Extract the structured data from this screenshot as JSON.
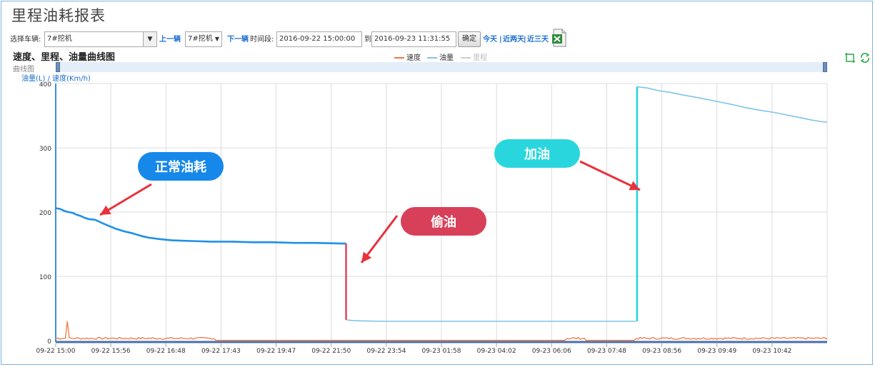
{
  "page": {
    "title": "里程油耗报表"
  },
  "toolbar": {
    "vehicle_label": "选择车辆:",
    "vehicle_value": "7#挖机",
    "prev_label": "上一辆",
    "vehicle_select_value": "7#挖机",
    "next_label": "下一辆",
    "period_label": "时间段:",
    "start_time": "2016-09-22 15:00:00",
    "to_label": "到",
    "end_time": "2016-09-23 11:31:55",
    "confirm_label": "确定",
    "quick_today": "今天",
    "quick_two_days": "近两天",
    "quick_three_days": "近三天",
    "separator": "|"
  },
  "chart_header": {
    "title": "速度、里程、油量曲线图",
    "navigator_label": "曲线图",
    "y_axis_title": "油量(L)  /  速度(Km/h)"
  },
  "colors": {
    "speed": "#f07840",
    "fuel": "#7ec4ea",
    "mileage": "#cccccc",
    "fuel_normal": "#1e90e8",
    "theft": "#d8405a",
    "refuel": "#26d4dc"
  },
  "chart_data": {
    "type": "line",
    "legend": [
      {
        "name": "速度",
        "color": "#f07840"
      },
      {
        "name": "油量",
        "color": "#7ec4ea"
      },
      {
        "name": "里程",
        "color": "#cccccc",
        "disabled": true
      }
    ],
    "x_tick_labels": [
      "09-22 15:00",
      "09-22 15:56",
      "09-22 16:48",
      "09-22 17:43",
      "09-22 19:47",
      "09-22 21:50",
      "09-22 23:54",
      "09-23 01:58",
      "09-23 04:02",
      "09-23 06:06",
      "09-23 07:48",
      "09-23 08:56",
      "09-23 09:49",
      "09-23 10:42"
    ],
    "x_range": [
      0,
      14
    ],
    "ylim": [
      0,
      400
    ],
    "y_ticks": [
      0,
      100,
      200,
      300,
      400
    ],
    "grid": true,
    "series": [
      {
        "name": "油量",
        "points": [
          [
            0,
            206
          ],
          [
            0.2,
            205
          ],
          [
            0.4,
            202
          ],
          [
            0.6,
            200
          ],
          [
            0.8,
            199
          ],
          [
            1.0,
            196
          ],
          [
            1.2,
            194
          ],
          [
            1.4,
            191
          ],
          [
            1.6,
            189
          ],
          [
            1.9,
            188
          ],
          [
            2.1,
            185
          ],
          [
            2.3,
            182
          ],
          [
            2.6,
            178
          ],
          [
            2.9,
            174
          ],
          [
            3.3,
            170
          ],
          [
            3.7,
            167
          ],
          [
            4.1,
            163
          ],
          [
            4.5,
            160
          ],
          [
            5.0,
            158
          ],
          [
            5.6,
            156
          ],
          [
            6.5,
            155
          ],
          [
            7.5,
            154
          ],
          [
            8.5,
            154
          ],
          [
            9.5,
            153
          ],
          [
            10.5,
            153
          ],
          [
            11.5,
            152
          ],
          [
            12.5,
            152
          ],
          [
            13.8,
            151
          ],
          [
            14,
            151
          ]
        ],
        "drop": [
          [
            0,
            151
          ],
          [
            0,
            32
          ]
        ],
        "after_theft": [
          [
            0,
            32
          ],
          [
            0.2,
            31
          ],
          [
            1,
            30
          ],
          [
            3,
            30
          ],
          [
            5,
            30
          ],
          [
            7,
            30
          ],
          [
            8.5,
            30
          ]
        ],
        "refuel_jump": [
          [
            0,
            30
          ],
          [
            0,
            395
          ]
        ],
        "after_refuel": [
          [
            0,
            395
          ],
          [
            0.5,
            393
          ],
          [
            1,
            389
          ],
          [
            1.6,
            386
          ],
          [
            2.2,
            382
          ],
          [
            2.9,
            378
          ],
          [
            3.5,
            374
          ],
          [
            4.1,
            370
          ],
          [
            4.7,
            366
          ],
          [
            5.2,
            362
          ],
          [
            5.9,
            358
          ],
          [
            6.5,
            355
          ],
          [
            7.1,
            351
          ],
          [
            7.7,
            347
          ],
          [
            8.3,
            343
          ],
          [
            8.9,
            340
          ],
          [
            9,
            340
          ]
        ]
      },
      {
        "name": "速度",
        "spike": 30,
        "baseline": 2
      }
    ],
    "annotations": [
      {
        "text": "正常油耗",
        "color": "#1688ea"
      },
      {
        "text": "偷油",
        "color": "#d8405a"
      },
      {
        "text": "加油",
        "color": "#2ad6de"
      }
    ]
  }
}
